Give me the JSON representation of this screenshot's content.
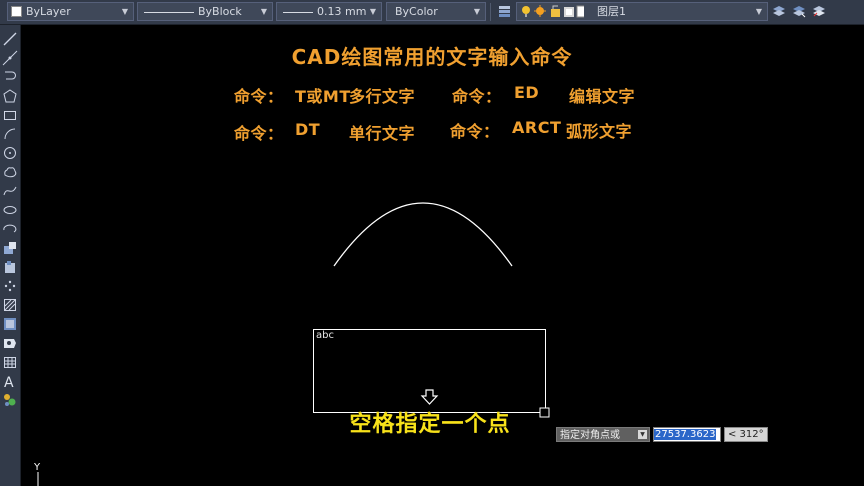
{
  "toolbar": {
    "layer_combo": "ByLayer",
    "linetype_combo": "ByBlock",
    "lineweight_combo": "0.13 mm",
    "color_combo": "ByColor",
    "layer_name": "图层1"
  },
  "drawing": {
    "title": "CAD绘图常用的文字输入命令",
    "commands": [
      {
        "prefix": "命令：",
        "cmd": "T或MT",
        "desc": "多行文字"
      },
      {
        "prefix": "命令：",
        "cmd": "ED",
        "desc": "编辑文字"
      },
      {
        "prefix": "命令：",
        "cmd": "DT",
        "desc": "单行文字"
      },
      {
        "prefix": "命令：",
        "cmd": "ARCT",
        "desc": "弧形文字"
      }
    ],
    "rect_label": "abc",
    "caption": "空格指定一个点"
  },
  "dynamic_input": {
    "prompt": "指定对角点或",
    "value": "27537.3623",
    "angle": "< 312°"
  },
  "ucs": {
    "y_label": "Y"
  },
  "colors": {
    "background": "#000000",
    "toolbar": "#323a49",
    "title_text": "#f0a030",
    "caption_text": "#f8e21a",
    "geometry": "#ffffff"
  }
}
